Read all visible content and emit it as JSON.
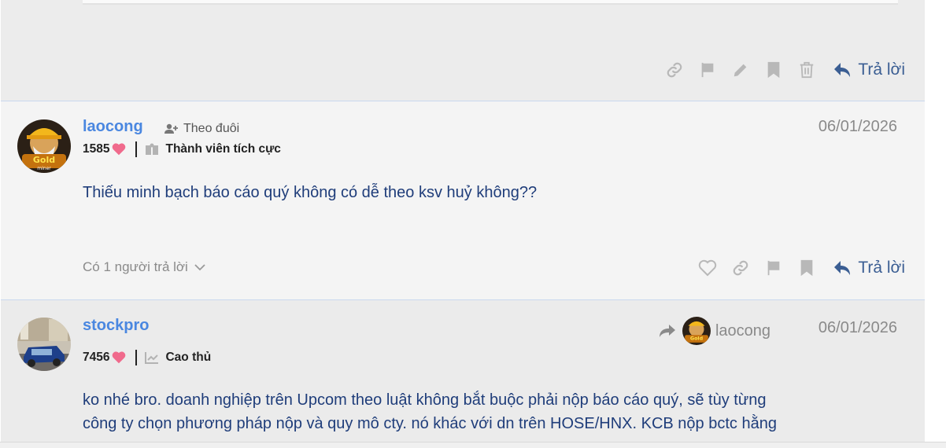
{
  "prev_post": {
    "actions": {
      "link": "link-icon",
      "flag": "flag-icon",
      "edit": "pencil-icon",
      "bookmark": "bookmark-icon",
      "delete": "trash-icon"
    },
    "reply_label": "Trả lời"
  },
  "post1": {
    "username": "laocong",
    "follow_label": "Theo đuôi",
    "points": "1585",
    "rank": "Thành viên tích cực",
    "date": "06/01/2026",
    "content": "Thiếu minh bạch báo cáo quý không có dễ theo ksv huỷ không??",
    "replies_label": "Có 1 người trả lời",
    "reply_label": "Trả lời",
    "avatar_text": "Gold miner"
  },
  "post2": {
    "username": "stockpro",
    "points": "7456",
    "rank": "Cao thủ",
    "quoted_user": "laocong",
    "date": "06/01/2026",
    "content_line1": "ko nhé bro. doanh nghiệp trên Upcom theo luật không bắt buộc phải nộp báo cáo quý, sẽ tùy từng",
    "content_line2": "công ty chọn phương pháp nộp và quy mô cty. nó khác với dn trên HOSE/HNX. KCB nộp bctc hằng"
  },
  "colors": {
    "accent": "#4a87e0",
    "content": "#1f3d7a",
    "reply": "#3b5e93",
    "heart": "#f06a8c",
    "icon": "#b8b8b8"
  }
}
